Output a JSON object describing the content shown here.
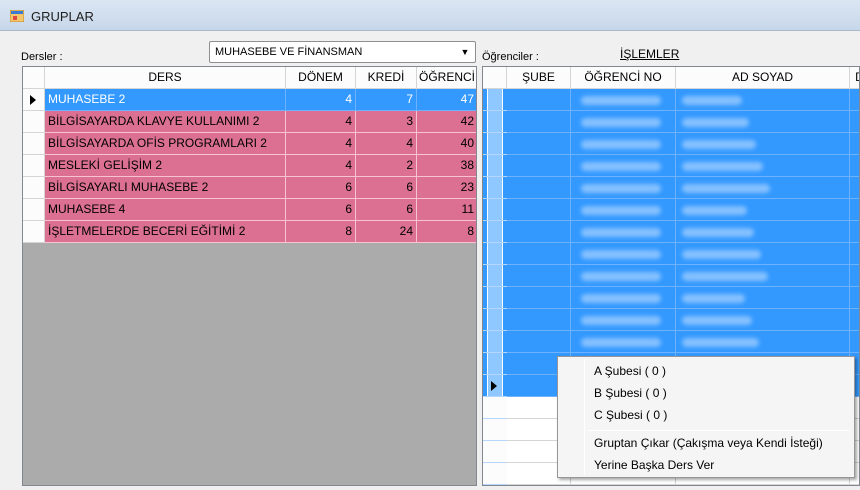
{
  "window": {
    "title": "GRUPLAR"
  },
  "left": {
    "dersler_label": "Dersler :",
    "combo_value": "MUHASEBE VE FİNANSMAN",
    "columns": [
      "DERS",
      "DÖNEM",
      "KREDİ",
      "ÖĞRENCİ"
    ],
    "rows": [
      [
        "MUHASEBE 2",
        "4",
        "7",
        "47"
      ],
      [
        "BİLGİSAYARDA KLAVYE KULLANIMI 2",
        "4",
        "3",
        "42"
      ],
      [
        "BİLGİSAYARDA OFİS PROGRAMLARI 2",
        "4",
        "4",
        "40"
      ],
      [
        "MESLEKİ GELİŞİM 2",
        "4",
        "2",
        "38"
      ],
      [
        "BİLGİSAYARLI MUHASEBE 2",
        "6",
        "6",
        "23"
      ],
      [
        "MUHASEBE 4",
        "6",
        "6",
        "11"
      ],
      [
        "İŞLETMELERDE BECERİ EĞİTİMİ 2",
        "8",
        "24",
        "8"
      ]
    ],
    "row_color_selected": "#3399ff",
    "row_color": "#db7093"
  },
  "right": {
    "ogrenciler_label": "Öğrenciler :",
    "islemler_link": "İŞLEMLER",
    "columns": [
      "ŞUBE",
      "ÖĞRENCİ NO",
      "AD SOYAD",
      "D"
    ]
  },
  "context_menu": {
    "items": [
      "A Şubesi ( 0 )",
      "B Şubesi ( 0 )",
      "C Şubesi ( 0 )",
      "Gruptan Çıkar (Çakışma veya Kendi İsteği)",
      "Yerine Başka Ders Ver"
    ]
  }
}
